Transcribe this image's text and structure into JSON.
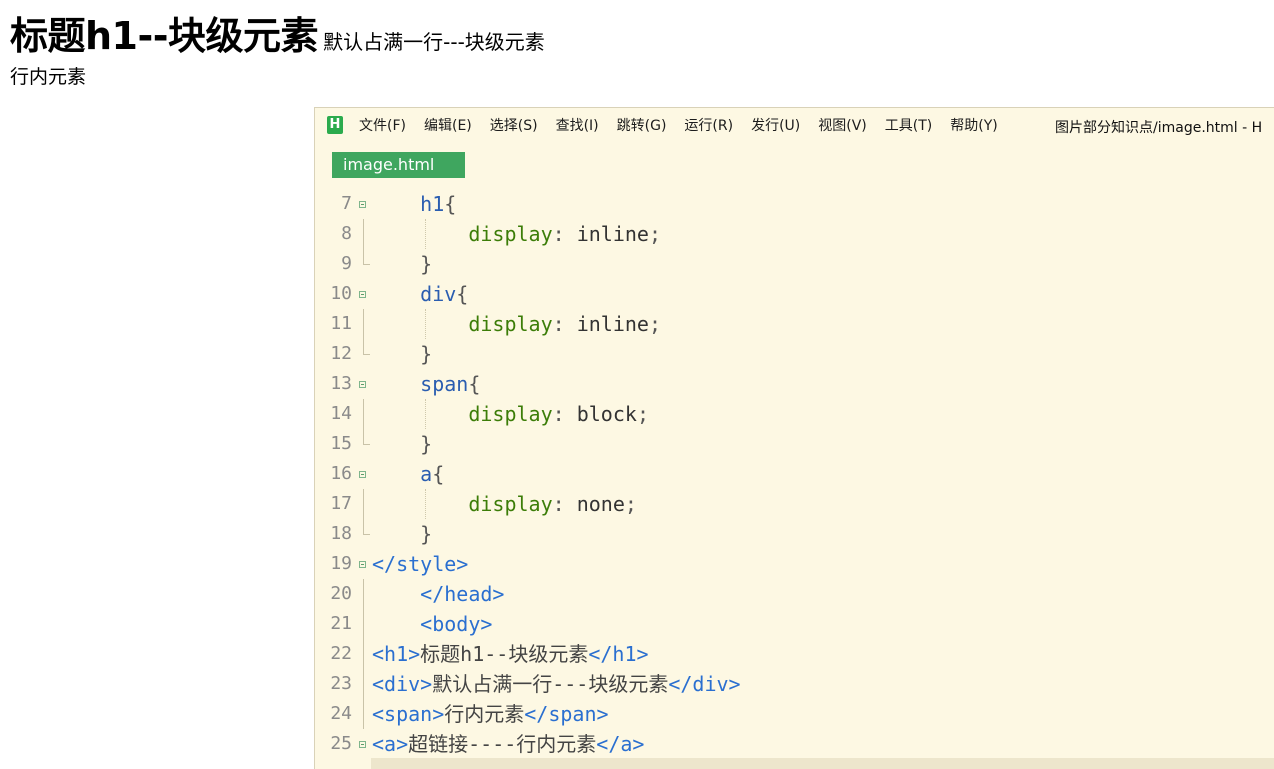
{
  "preview": {
    "h1_text": "标题h1--块级元素",
    "div_text": "默认占满一行---块级元素",
    "span_text": "行内元素"
  },
  "editor": {
    "logo_letter": "H",
    "menu": [
      "文件(F)",
      "编辑(E)",
      "选择(S)",
      "查找(I)",
      "跳转(G)",
      "运行(R)",
      "发行(U)",
      "视图(V)",
      "工具(T)",
      "帮助(Y)"
    ],
    "window_title": "图片部分知识点/image.html - H",
    "tab_label": "image.html",
    "lines": [
      {
        "n": "7",
        "fold": true,
        "code": "    h1{"
      },
      {
        "n": "8",
        "fold": false,
        "code": "        display: inline;"
      },
      {
        "n": "9",
        "fold": false,
        "code": "    }"
      },
      {
        "n": "10",
        "fold": true,
        "code": "    div{"
      },
      {
        "n": "11",
        "fold": false,
        "code": "        display: inline;"
      },
      {
        "n": "12",
        "fold": false,
        "code": "    }"
      },
      {
        "n": "13",
        "fold": true,
        "code": "    span{"
      },
      {
        "n": "14",
        "fold": false,
        "code": "        display: block;"
      },
      {
        "n": "15",
        "fold": false,
        "code": "    }"
      },
      {
        "n": "16",
        "fold": true,
        "code": "    a{"
      },
      {
        "n": "17",
        "fold": false,
        "code": "        display: none;"
      },
      {
        "n": "18",
        "fold": false,
        "code": "    }"
      },
      {
        "n": "19",
        "fold": true,
        "code": "</style>"
      },
      {
        "n": "20",
        "fold": false,
        "code": "    </head>"
      },
      {
        "n": "21",
        "fold": false,
        "code": "    <body>"
      },
      {
        "n": "22",
        "fold": false,
        "code": "<h1>标题h1--块级元素</h1>"
      },
      {
        "n": "23",
        "fold": false,
        "code": "<div>默认占满一行---块级元素</div>"
      },
      {
        "n": "24",
        "fold": false,
        "code": "<span>行内元素</span>"
      },
      {
        "n": "25",
        "fold": true,
        "code": "<a>超链接----行内元素</a>"
      }
    ]
  }
}
